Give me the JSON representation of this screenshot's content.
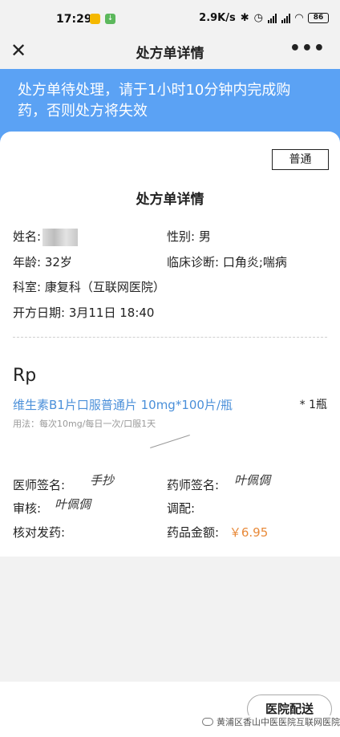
{
  "status": {
    "time": "17:29",
    "speed": "2.9K/s",
    "battery": "86"
  },
  "nav": {
    "title": "处方单详情",
    "close_icon": "close-icon",
    "more_icon": "more-icon"
  },
  "banner": {
    "line1": "处方单待处理，请于1小时10分钟内完成购",
    "line2": "药，否则处方将失效"
  },
  "prescription": {
    "badge": "普通",
    "title": "处方单详情",
    "name_label": "姓名:",
    "gender_label": "性别:",
    "gender": "男",
    "age_label": "年龄:",
    "age": "32岁",
    "diagnosis_label": "临床诊断:",
    "diagnosis": "口角炎;喘病",
    "dept_label": "科室:",
    "dept": "康复科（互联网医院）",
    "date_label": "开方日期:",
    "date": "3月11日 18:40",
    "rp": "Rp",
    "drug_name": "维生素B1片口服普通片 10mg*100片/瓶",
    "drug_qty": "* 1瓶",
    "drug_usage": "用法：每次10mg/每日一次/口服1天",
    "doctor_sign_label": "医师签名:",
    "doctor_sign": "手抄",
    "pharmacist_sign_label": "药师签名:",
    "pharmacist_sign": "叶佩倜",
    "review_label": "审核:",
    "review_sign": "叶佩倜",
    "dispense_label": "调配:",
    "check_label": "核对发药:",
    "amount_label": "药品金额:",
    "amount": "￥6.95"
  },
  "footer": {
    "deliver_button": "医院配送",
    "watermark": "黄浦区香山中医医院互联网医院"
  },
  "colors": {
    "banner": "#5ba2f4",
    "drug": "#4a8fd9",
    "price": "#e88a3a"
  }
}
